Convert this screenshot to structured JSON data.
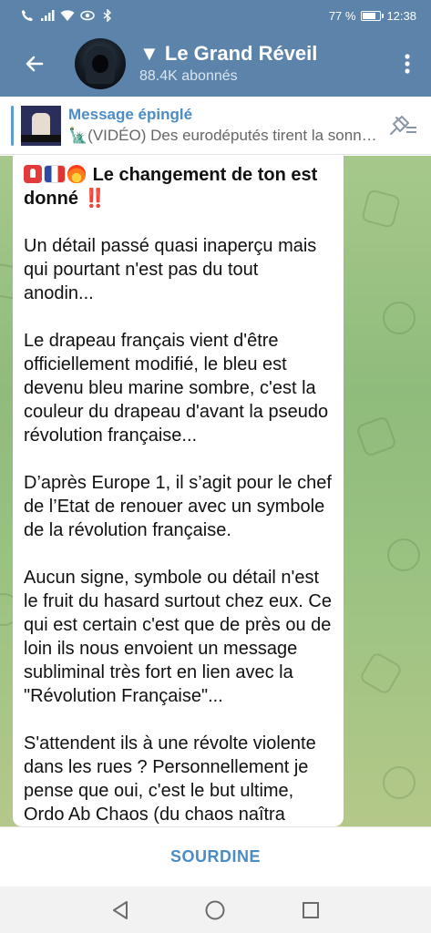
{
  "status_bar": {
    "battery_text": "77 %",
    "battery_level": 0.77,
    "time": "12:38",
    "icons": [
      "call-icon",
      "signal-icon",
      "wifi-icon",
      "eye-icon",
      "bluetooth-icon",
      "battery-icon"
    ]
  },
  "header": {
    "title": "▼ Le Grand Réveil",
    "subscribers": "88.4K abonnés"
  },
  "pinned": {
    "label": "Message épinglé",
    "preview": "🗽(VIDÉO) Des eurodéputés tirent la sonnette d'alarme"
  },
  "message": {
    "heading": "Le changement de ton est donné",
    "heading_suffix": "‼️",
    "paragraphs": [
      "Un détail passé quasi inaperçu mais qui pourtant n'est pas du tout anodin...",
      "Le drapeau français vient d'être officiellement modifié, le bleu est devenu bleu marine sombre, c'est la couleur du drapeau d'avant la pseudo révolution française...",
      "D’après Europe 1, il s’agit pour le chef de l’Etat de renouer avec un symbole de la révolution française.",
      "Aucun signe, symbole ou détail n'est le fruit du hasard surtout chez eux. Ce qui est certain c'est que de près ou de loin ils nous envoient un message subliminal très fort en lien avec la \"Révolution Française\"...",
      "S'attendent ils à une révolte violente dans les rues ? Personnellement je pense que oui, c'est le but ultime, Ordo Ab Chaos (du chaos naîtra l'ordre)."
    ]
  },
  "bottom": {
    "mute_label": "SOURDINE"
  },
  "colors": {
    "header_bg": "#5c84ab",
    "accent": "#4c8cc4",
    "chat_bg": "#9cc382"
  }
}
